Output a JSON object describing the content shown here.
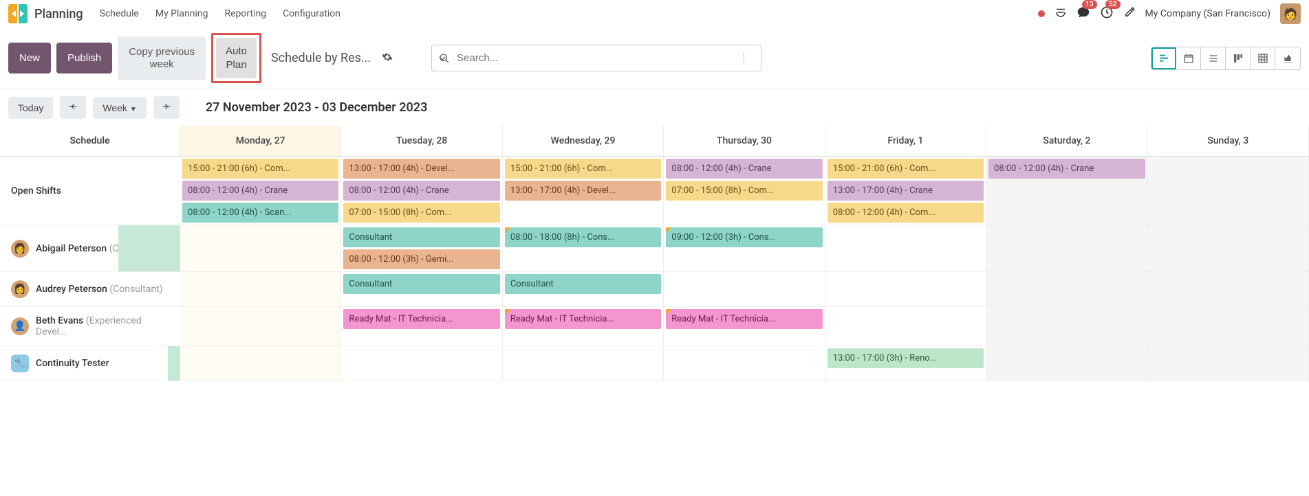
{
  "app": {
    "title": "Planning"
  },
  "nav": {
    "items": [
      "Schedule",
      "My Planning",
      "Reporting",
      "Configuration"
    ]
  },
  "header": {
    "badges": {
      "messages": "13",
      "activities": "52"
    },
    "company": "My Company (San Francisco)"
  },
  "toolbar": {
    "new": "New",
    "publish": "Publish",
    "copy": "Copy previous\nweek",
    "auto": "Auto\nPlan",
    "view_title": "Schedule by Res...",
    "search_placeholder": "Search..."
  },
  "daterow": {
    "today": "Today",
    "span": "Week",
    "range": "27 November 2023 - 03 December 2023"
  },
  "gantt": {
    "row_label_header": "Schedule",
    "days": [
      {
        "label": "Monday, 27",
        "today": true
      },
      {
        "label": "Tuesday, 28"
      },
      {
        "label": "Wednesday, 29"
      },
      {
        "label": "Thursday, 30"
      },
      {
        "label": "Friday, 1"
      },
      {
        "label": "Saturday, 2",
        "weekend": true
      },
      {
        "label": "Sunday, 3",
        "weekend": true
      }
    ],
    "rows": [
      {
        "label": "Open Shifts",
        "cells": [
          [
            {
              "text": "15:00 - 21:00 (6h) - Com...",
              "color": "yellow"
            },
            {
              "text": "08:00 - 12:00 (4h) - Crane",
              "color": "purple"
            },
            {
              "text": "08:00 - 12:00 (4h) - Scan...",
              "color": "teal"
            }
          ],
          [
            {
              "text": "13:00 - 17:00 (4h) - Devel...",
              "color": "orange"
            },
            {
              "text": "08:00 - 12:00 (4h) - Crane",
              "color": "purple"
            },
            {
              "text": "07:00 - 15:00 (8h) - Com...",
              "color": "yellow"
            }
          ],
          [
            {
              "text": "15:00 - 21:00 (6h) - Com...",
              "color": "yellow"
            },
            {
              "text": "13:00 - 17:00 (4h) - Devel...",
              "color": "orange"
            }
          ],
          [
            {
              "text": "08:00 - 12:00 (4h) - Crane",
              "color": "purple"
            },
            {
              "text": "07:00 - 15:00 (8h) - Com...",
              "color": "yellow"
            }
          ],
          [
            {
              "text": "15:00 - 21:00 (6h) - Com...",
              "color": "yellow"
            },
            {
              "text": "13:00 - 17:00 (4h) - Crane",
              "color": "purple"
            },
            {
              "text": "08:00 - 12:00 (4h) - Com...",
              "color": "yellow"
            }
          ],
          [
            {
              "text": "08:00 - 12:00 (4h) - Crane",
              "color": "purple"
            }
          ],
          []
        ]
      },
      {
        "label_name": "Abigail Peterson",
        "label_role": "(Consultant)",
        "avatar": "👩",
        "marker": "big",
        "cells": [
          [],
          [
            {
              "text": "Consultant",
              "color": "teal"
            },
            {
              "text": "08:00 - 12:00 (3h) - Gemi...",
              "color": "orange"
            }
          ],
          [
            {
              "text": "08:00 - 18:00 (8h) - Cons...",
              "color": "teal",
              "corner": true
            }
          ],
          [
            {
              "text": "09:00 - 12:00 (3h) - Cons...",
              "color": "teal",
              "corner": true
            }
          ],
          [],
          [],
          []
        ]
      },
      {
        "label_name": "Audrey Peterson",
        "label_role": "(Consultant)",
        "avatar": "👩",
        "cells": [
          [],
          [
            {
              "text": "Consultant",
              "color": "teal"
            }
          ],
          [
            {
              "text": "Consultant",
              "color": "teal"
            }
          ],
          [],
          [],
          [],
          []
        ]
      },
      {
        "label_name": "Beth Evans",
        "label_role": "(Experienced Devel...",
        "avatar": "👤",
        "cells": [
          [],
          [
            {
              "text": "Ready Mat - IT Technicia...",
              "color": "pink"
            }
          ],
          [
            {
              "text": "Ready Mat - IT Technicia...",
              "color": "pink",
              "corner": true
            }
          ],
          [
            {
              "text": "Ready Mat - IT Technicia...",
              "color": "pink",
              "corner": true
            }
          ],
          [],
          [],
          []
        ]
      },
      {
        "label_name": "Continuity Tester",
        "avatar": "🔧",
        "avatar_class": "tool",
        "marker": "small",
        "cells": [
          [],
          [],
          [],
          [],
          [
            {
              "text": "13:00 - 17:00 (3h) - Reno...",
              "color": "green"
            }
          ],
          [],
          []
        ]
      }
    ]
  }
}
